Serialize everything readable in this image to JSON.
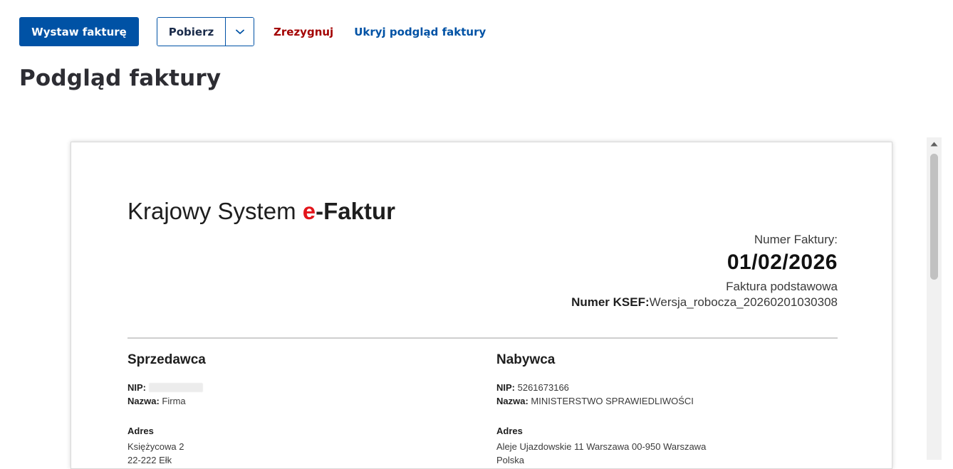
{
  "toolbar": {
    "issue_label": "Wystaw fakturę",
    "download_label": "Pobierz",
    "cancel_label": "Zrezygnuj",
    "hide_preview_label": "Ukryj podgląd faktury"
  },
  "page": {
    "title": "Podgląd faktury"
  },
  "invoice": {
    "brand": {
      "prefix": "Krajowy System ",
      "accent": "e",
      "separator": "-",
      "suffix": "Faktur"
    },
    "number_label": "Numer Faktury:",
    "number": "01/02/2026",
    "kind": "Faktura podstawowa",
    "ksef_label": "Numer KSEF:",
    "ksef_value": "Wersja_robocza_20260201030308",
    "seller": {
      "heading": "Sprzedawca",
      "nip_label": "NIP:",
      "nip_value": "",
      "name_label": "Nazwa:",
      "name_value": " Firma",
      "address_heading": "Adres",
      "address_line1": "Księżycowa 2",
      "address_line2": "22-222 Ełk"
    },
    "buyer": {
      "heading": "Nabywca",
      "nip_label": "NIP:",
      "nip_value": " 5261673166",
      "name_label": "Nazwa:",
      "name_value": " MINISTERSTWO SPRAWIEDLIWOŚCI",
      "address_heading": "Adres",
      "address_line1": "Aleje Ujazdowskie 11 Warszawa 00-950 Warszawa",
      "address_line2": "Polska"
    }
  },
  "colors": {
    "primary": "#0052a5",
    "danger": "#a30000",
    "brand_accent": "#e3151b"
  },
  "icons": {
    "download_dropdown": "chevron-down-icon",
    "scroll_up": "triangle-up-icon"
  }
}
